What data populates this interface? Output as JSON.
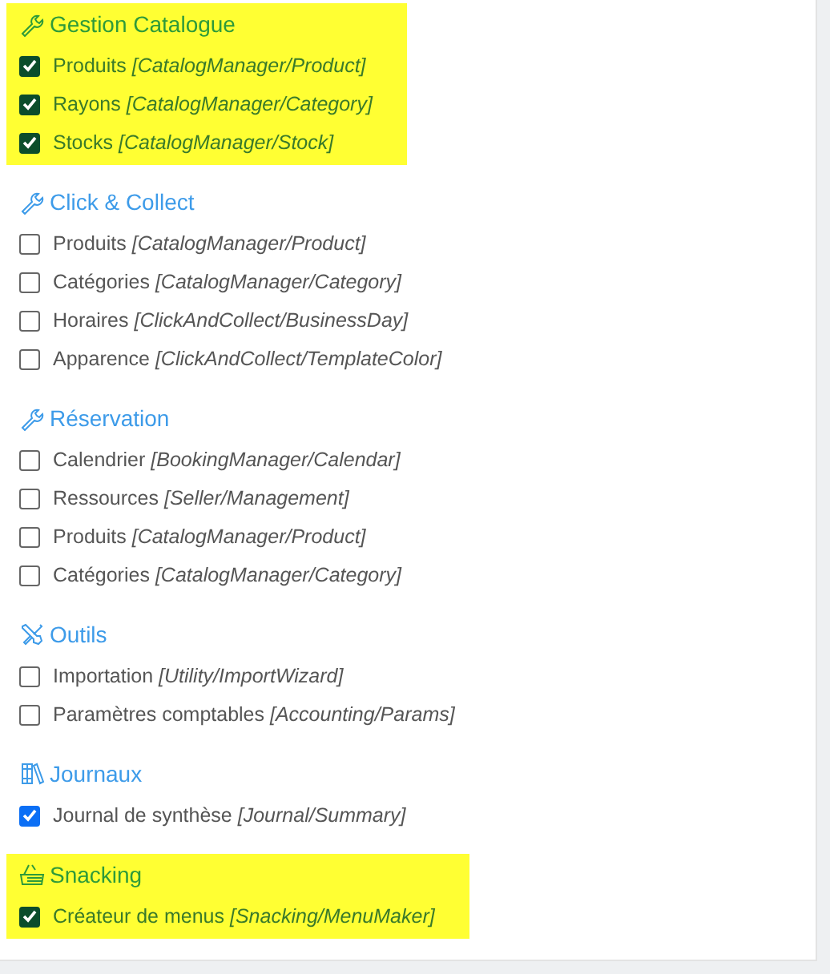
{
  "sections": [
    {
      "title": "Gestion Catalogue",
      "kind": "wrench",
      "highlighted": true,
      "items": [
        {
          "label": "Produits",
          "path": "[CatalogManager/Product]",
          "checked": true
        },
        {
          "label": "Rayons",
          "path": "[CatalogManager/Category]",
          "checked": true
        },
        {
          "label": "Stocks",
          "path": "[CatalogManager/Stock]",
          "checked": true
        }
      ]
    },
    {
      "title": "Click & Collect",
      "kind": "wrench",
      "highlighted": false,
      "items": [
        {
          "label": "Produits",
          "path": "[CatalogManager/Product]",
          "checked": false
        },
        {
          "label": "Catégories",
          "path": "[CatalogManager/Category]",
          "checked": false
        },
        {
          "label": "Horaires",
          "path": "[ClickAndCollect/BusinessDay]",
          "checked": false
        },
        {
          "label": "Apparence",
          "path": "[ClickAndCollect/TemplateColor]",
          "checked": false
        }
      ]
    },
    {
      "title": "Réservation",
      "kind": "wrench",
      "highlighted": false,
      "items": [
        {
          "label": "Calendrier",
          "path": "[BookingManager/Calendar]",
          "checked": false
        },
        {
          "label": "Ressources",
          "path": "[Seller/Management]",
          "checked": false
        },
        {
          "label": "Produits",
          "path": "[CatalogManager/Product]",
          "checked": false
        },
        {
          "label": "Catégories",
          "path": "[CatalogManager/Category]",
          "checked": false
        }
      ]
    },
    {
      "title": "Outils",
      "kind": "tools",
      "highlighted": false,
      "items": [
        {
          "label": "Importation",
          "path": "[Utility/ImportWizard]",
          "checked": false
        },
        {
          "label": "Paramètres comptables",
          "path": "[Accounting/Params]",
          "checked": false
        }
      ]
    },
    {
      "title": "Journaux",
      "kind": "books",
      "highlighted": false,
      "items": [
        {
          "label": "Journal de synthèse",
          "path": "[Journal/Summary]",
          "checked": true
        }
      ]
    },
    {
      "title": "Snacking",
      "kind": "basket",
      "highlighted": true,
      "items": [
        {
          "label": "Créateur de menus",
          "path": "[Snacking/MenuMaker]",
          "checked": true
        }
      ]
    }
  ]
}
